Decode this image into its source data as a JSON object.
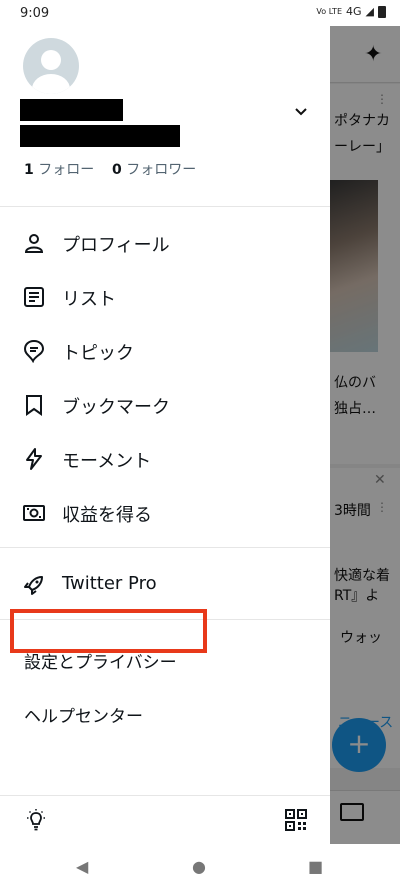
{
  "status": {
    "time": "9:09",
    "network": "Vo LTE",
    "signal": "4G"
  },
  "profile": {
    "following_count": "1",
    "following_label": "フォロー",
    "followers_count": "0",
    "followers_label": "フォロワー"
  },
  "menu": [
    {
      "label": "プロフィール",
      "icon": "person-icon"
    },
    {
      "label": "リスト",
      "icon": "list-icon"
    },
    {
      "label": "トピック",
      "icon": "topic-icon"
    },
    {
      "label": "ブックマーク",
      "icon": "bookmark-icon"
    },
    {
      "label": "モーメント",
      "icon": "lightning-icon"
    },
    {
      "label": "収益を得る",
      "icon": "money-icon"
    }
  ],
  "pro": {
    "label": "Twitter Pro",
    "icon": "rocket-icon"
  },
  "settings": {
    "label": "設定とプライバシー"
  },
  "help": {
    "label": "ヘルプセンター"
  },
  "background": {
    "snippet1": "ポタナカ",
    "snippet2": "ーレー」",
    "snippet3": "仏のバ",
    "snippet4": "独占…",
    "snippet5": "3時間",
    "snippet6": "快適な着",
    "snippet7": "RT』よ",
    "snippet8": "ウォッ",
    "snippet9": "ニュース"
  },
  "colors": {
    "accent": "#1d9bf0",
    "highlight": "#e8391a"
  }
}
